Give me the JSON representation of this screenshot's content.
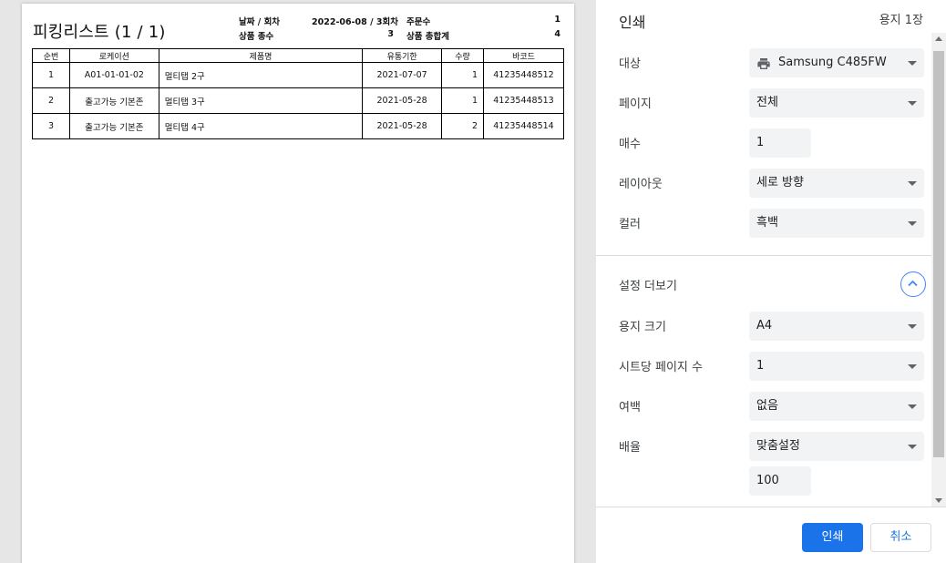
{
  "document": {
    "title": "피킹리스트 (1 / 1)",
    "meta": {
      "date_label": "날짜 / 회차",
      "date_value": "2022-06-08 / 3회차",
      "order_label": "주문수",
      "order_value": "1",
      "product_kinds_label": "상품 종수",
      "product_kinds_value": "3",
      "product_total_label": "상품 총합계",
      "product_total_value": "4"
    },
    "table": {
      "headers": [
        "순번",
        "로케이션",
        "제품명",
        "유통기한",
        "수량",
        "바코드"
      ],
      "rows": [
        [
          "1",
          "A01-01-01-02",
          "멀티탭 2구",
          "2021-07-07",
          "1",
          "41235448512"
        ],
        [
          "2",
          "출고가능 기본존",
          "멀티탭 3구",
          "2021-05-28",
          "1",
          "41235448513"
        ],
        [
          "3",
          "출고가능 기본존",
          "멀티탭 4구",
          "2021-05-28",
          "2",
          "41235448514"
        ]
      ]
    }
  },
  "panel": {
    "title": "인쇄",
    "sheet_count": "용지 1장",
    "settings": {
      "destination_label": "대상",
      "destination_value": "Samsung C485FW",
      "pages_label": "페이지",
      "pages_value": "전체",
      "copies_label": "매수",
      "copies_value": "1",
      "layout_label": "레이아웃",
      "layout_value": "세로 방향",
      "color_label": "컬러",
      "color_value": "흑백",
      "more_label": "설정 더보기",
      "paper_size_label": "용지 크기",
      "paper_size_value": "A4",
      "pages_per_sheet_label": "시트당 페이지 수",
      "pages_per_sheet_value": "1",
      "margins_label": "여백",
      "margins_value": "없음",
      "scale_label": "배율",
      "scale_value": "맞춤설정",
      "scale_amount": "100"
    },
    "buttons": {
      "print": "인쇄",
      "cancel": "취소"
    }
  },
  "colors": {
    "primary": "#1a73e8",
    "field_bg": "#f1f3f4",
    "preview_bg": "#e6e6e6"
  }
}
